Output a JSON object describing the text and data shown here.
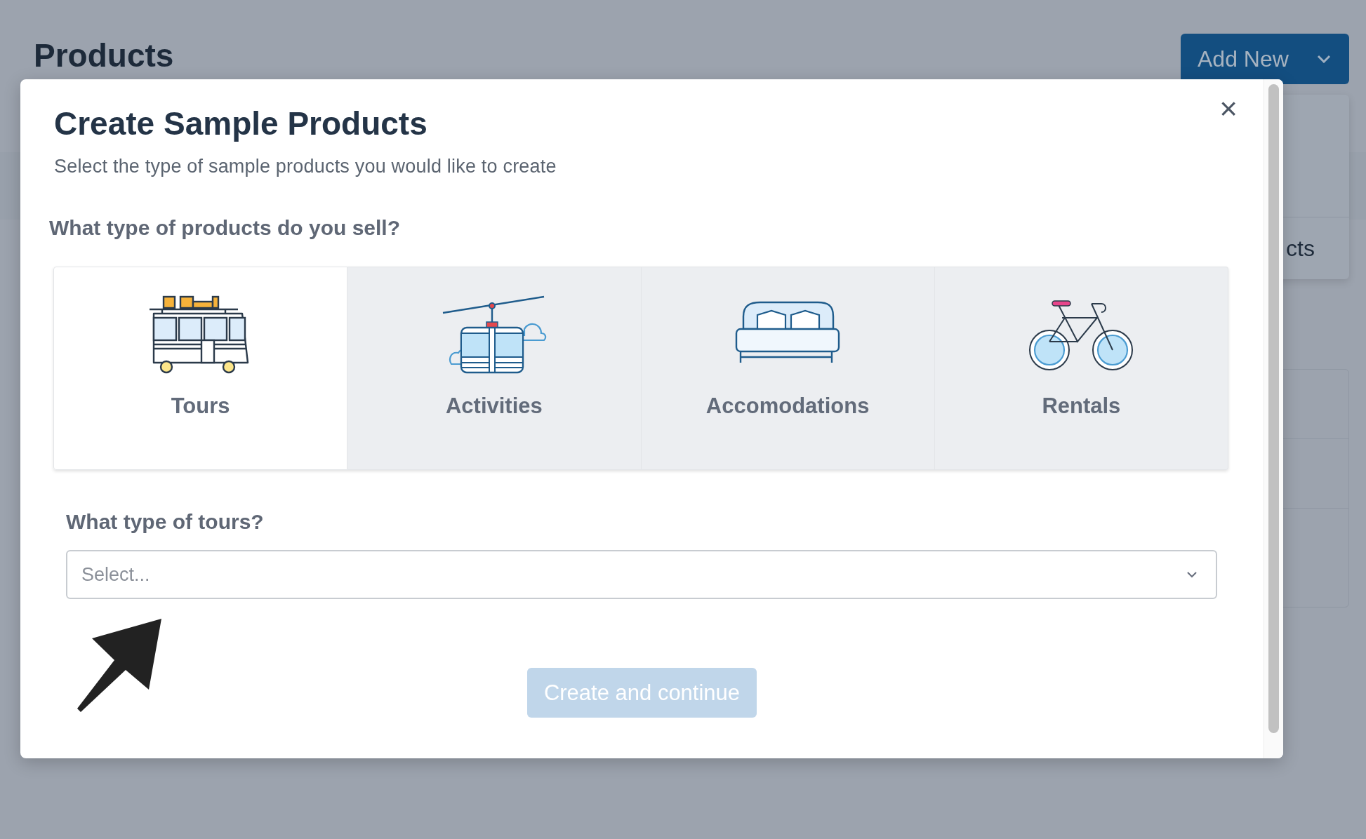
{
  "page": {
    "title": "Products",
    "add_button": {
      "label": "Add New"
    },
    "menu_item": "cts"
  },
  "modal": {
    "title": "Create Sample Products",
    "subtitle": "Select the type of sample products you would like to create",
    "close_symbol": "×",
    "question": "What type of products do you sell?",
    "product_types": [
      {
        "label": "Tours",
        "kind": "bus",
        "selected": true
      },
      {
        "label": "Activities",
        "kind": "gondola",
        "selected": false
      },
      {
        "label": "Accomodations",
        "kind": "bed",
        "selected": false
      },
      {
        "label": "Rentals",
        "kind": "bicycle",
        "selected": false
      }
    ],
    "subquestion": "What type of tours?",
    "select": {
      "placeholder": "Select..."
    },
    "submit": {
      "label": "Create and continue",
      "disabled": true
    }
  }
}
